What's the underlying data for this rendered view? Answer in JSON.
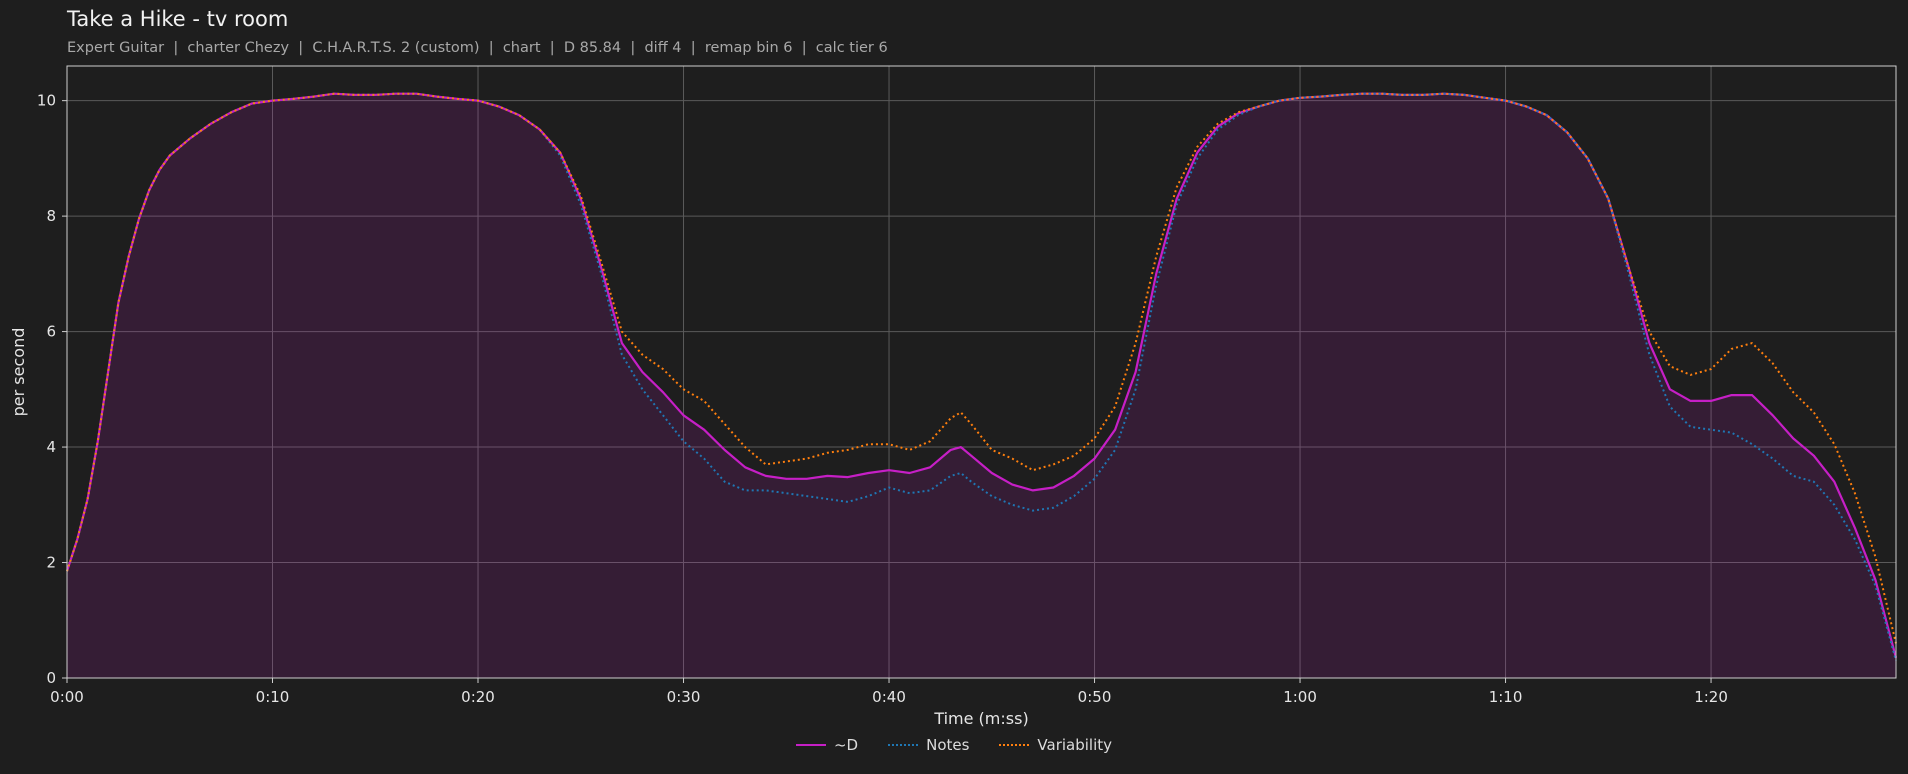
{
  "chart_data": {
    "type": "area",
    "title": "Take a Hike - tv room",
    "subtitle": "Expert Guitar  |  charter Chezy  |  C.H.A.R.T.S. 2 (custom)  |  chart  |  D 85.84  |  diff 4  |  remap bin 6  |  calc tier 6",
    "xlabel": "Time (m:ss)",
    "ylabel": "per second",
    "xlim": [
      0,
      89
    ],
    "ylim": [
      0,
      10.6
    ],
    "x_ticks": [
      0,
      10,
      20,
      30,
      40,
      50,
      60,
      70,
      80
    ],
    "x_tick_labels": [
      "0:00",
      "0:10",
      "0:20",
      "0:30",
      "0:40",
      "0:50",
      "1:00",
      "1:10",
      "1:20"
    ],
    "y_ticks": [
      0,
      2,
      4,
      6,
      8,
      10
    ],
    "y_tick_labels": [
      "0",
      "2",
      "4",
      "6",
      "8",
      "10"
    ],
    "grid": true,
    "legend_position": "bottom-center",
    "series": [
      {
        "name": "~D",
        "color": "#c61fc6",
        "style": "solid",
        "fill": true,
        "points": [
          [
            0,
            1.85
          ],
          [
            0.5,
            2.4
          ],
          [
            1,
            3.1
          ],
          [
            1.5,
            4.1
          ],
          [
            2,
            5.3
          ],
          [
            2.5,
            6.5
          ],
          [
            3,
            7.3
          ],
          [
            3.5,
            7.95
          ],
          [
            4,
            8.45
          ],
          [
            4.5,
            8.8
          ],
          [
            5,
            9.05
          ],
          [
            6,
            9.35
          ],
          [
            7,
            9.6
          ],
          [
            8,
            9.8
          ],
          [
            9,
            9.95
          ],
          [
            10,
            10.0
          ],
          [
            11,
            10.03
          ],
          [
            12,
            10.07
          ],
          [
            13,
            10.12
          ],
          [
            14,
            10.1
          ],
          [
            15,
            10.1
          ],
          [
            16,
            10.12
          ],
          [
            17,
            10.12
          ],
          [
            18,
            10.07
          ],
          [
            19,
            10.03
          ],
          [
            20,
            10.0
          ],
          [
            21,
            9.9
          ],
          [
            22,
            9.75
          ],
          [
            23,
            9.5
          ],
          [
            24,
            9.1
          ],
          [
            25,
            8.3
          ],
          [
            26,
            7.1
          ],
          [
            27,
            5.8
          ],
          [
            28,
            5.3
          ],
          [
            29,
            4.95
          ],
          [
            30,
            4.55
          ],
          [
            31,
            4.3
          ],
          [
            32,
            3.95
          ],
          [
            33,
            3.65
          ],
          [
            34,
            3.5
          ],
          [
            35,
            3.45
          ],
          [
            36,
            3.45
          ],
          [
            37,
            3.5
          ],
          [
            38,
            3.48
          ],
          [
            39,
            3.55
          ],
          [
            40,
            3.6
          ],
          [
            41,
            3.55
          ],
          [
            42,
            3.65
          ],
          [
            43,
            3.95
          ],
          [
            43.5,
            4.0
          ],
          [
            44,
            3.85
          ],
          [
            45,
            3.55
          ],
          [
            46,
            3.35
          ],
          [
            47,
            3.25
          ],
          [
            48,
            3.3
          ],
          [
            49,
            3.5
          ],
          [
            50,
            3.8
          ],
          [
            51,
            4.3
          ],
          [
            52,
            5.3
          ],
          [
            53,
            7.0
          ],
          [
            54,
            8.3
          ],
          [
            55,
            9.1
          ],
          [
            56,
            9.55
          ],
          [
            57,
            9.78
          ],
          [
            58,
            9.9
          ],
          [
            59,
            10.0
          ],
          [
            60,
            10.05
          ],
          [
            61,
            10.07
          ],
          [
            62,
            10.1
          ],
          [
            63,
            10.12
          ],
          [
            64,
            10.12
          ],
          [
            65,
            10.1
          ],
          [
            66,
            10.1
          ],
          [
            67,
            10.12
          ],
          [
            68,
            10.1
          ],
          [
            69,
            10.05
          ],
          [
            70,
            10.0
          ],
          [
            71,
            9.9
          ],
          [
            72,
            9.75
          ],
          [
            73,
            9.45
          ],
          [
            74,
            9.0
          ],
          [
            75,
            8.3
          ],
          [
            76,
            7.1
          ],
          [
            77,
            5.8
          ],
          [
            78,
            5.0
          ],
          [
            79,
            4.8
          ],
          [
            80,
            4.8
          ],
          [
            81,
            4.9
          ],
          [
            82,
            4.9
          ],
          [
            83,
            4.55
          ],
          [
            84,
            4.15
          ],
          [
            85,
            3.85
          ],
          [
            86,
            3.4
          ],
          [
            87,
            2.6
          ],
          [
            88,
            1.7
          ],
          [
            89,
            0.35
          ]
        ]
      },
      {
        "name": "Notes",
        "color": "#1f77b4",
        "style": "dotted",
        "fill": false,
        "points": [
          [
            0,
            1.85
          ],
          [
            0.5,
            2.4
          ],
          [
            1,
            3.1
          ],
          [
            1.5,
            4.1
          ],
          [
            2,
            5.3
          ],
          [
            2.5,
            6.5
          ],
          [
            3,
            7.3
          ],
          [
            3.5,
            7.95
          ],
          [
            4,
            8.45
          ],
          [
            4.5,
            8.8
          ],
          [
            5,
            9.05
          ],
          [
            6,
            9.35
          ],
          [
            7,
            9.6
          ],
          [
            8,
            9.8
          ],
          [
            9,
            9.95
          ],
          [
            10,
            10.0
          ],
          [
            11,
            10.03
          ],
          [
            12,
            10.07
          ],
          [
            13,
            10.12
          ],
          [
            14,
            10.1
          ],
          [
            15,
            10.1
          ],
          [
            16,
            10.12
          ],
          [
            17,
            10.12
          ],
          [
            18,
            10.07
          ],
          [
            19,
            10.03
          ],
          [
            20,
            10.0
          ],
          [
            21,
            9.9
          ],
          [
            22,
            9.75
          ],
          [
            23,
            9.5
          ],
          [
            24,
            9.05
          ],
          [
            25,
            8.2
          ],
          [
            26,
            7.0
          ],
          [
            27,
            5.6
          ],
          [
            28,
            5.0
          ],
          [
            29,
            4.55
          ],
          [
            30,
            4.1
          ],
          [
            31,
            3.8
          ],
          [
            32,
            3.4
          ],
          [
            33,
            3.25
          ],
          [
            34,
            3.25
          ],
          [
            35,
            3.2
          ],
          [
            36,
            3.15
          ],
          [
            37,
            3.1
          ],
          [
            38,
            3.05
          ],
          [
            39,
            3.15
          ],
          [
            40,
            3.3
          ],
          [
            41,
            3.2
          ],
          [
            42,
            3.25
          ],
          [
            43,
            3.5
          ],
          [
            43.5,
            3.55
          ],
          [
            44,
            3.4
          ],
          [
            45,
            3.15
          ],
          [
            46,
            3.0
          ],
          [
            47,
            2.9
          ],
          [
            48,
            2.95
          ],
          [
            49,
            3.15
          ],
          [
            50,
            3.45
          ],
          [
            51,
            3.95
          ],
          [
            52,
            5.0
          ],
          [
            53,
            6.8
          ],
          [
            54,
            8.2
          ],
          [
            55,
            9.0
          ],
          [
            56,
            9.5
          ],
          [
            57,
            9.75
          ],
          [
            58,
            9.9
          ],
          [
            59,
            10.0
          ],
          [
            60,
            10.05
          ],
          [
            61,
            10.07
          ],
          [
            62,
            10.1
          ],
          [
            63,
            10.12
          ],
          [
            64,
            10.12
          ],
          [
            65,
            10.1
          ],
          [
            66,
            10.1
          ],
          [
            67,
            10.12
          ],
          [
            68,
            10.1
          ],
          [
            69,
            10.05
          ],
          [
            70,
            10.0
          ],
          [
            71,
            9.9
          ],
          [
            72,
            9.75
          ],
          [
            73,
            9.45
          ],
          [
            74,
            9.0
          ],
          [
            75,
            8.3
          ],
          [
            76,
            7.0
          ],
          [
            77,
            5.6
          ],
          [
            78,
            4.7
          ],
          [
            79,
            4.35
          ],
          [
            80,
            4.3
          ],
          [
            81,
            4.25
          ],
          [
            82,
            4.05
          ],
          [
            83,
            3.8
          ],
          [
            84,
            3.5
          ],
          [
            85,
            3.4
          ],
          [
            86,
            3.0
          ],
          [
            87,
            2.4
          ],
          [
            88,
            1.6
          ],
          [
            89,
            0.3
          ]
        ]
      },
      {
        "name": "Variability",
        "color": "#ff7f0e",
        "style": "dotted",
        "fill": false,
        "points": [
          [
            0,
            1.85
          ],
          [
            0.5,
            2.4
          ],
          [
            1,
            3.1
          ],
          [
            1.5,
            4.1
          ],
          [
            2,
            5.3
          ],
          [
            2.5,
            6.5
          ],
          [
            3,
            7.3
          ],
          [
            3.5,
            7.95
          ],
          [
            4,
            8.45
          ],
          [
            4.5,
            8.8
          ],
          [
            5,
            9.05
          ],
          [
            6,
            9.35
          ],
          [
            7,
            9.6
          ],
          [
            8,
            9.8
          ],
          [
            9,
            9.95
          ],
          [
            10,
            10.0
          ],
          [
            11,
            10.03
          ],
          [
            12,
            10.07
          ],
          [
            13,
            10.12
          ],
          [
            14,
            10.1
          ],
          [
            15,
            10.1
          ],
          [
            16,
            10.12
          ],
          [
            17,
            10.12
          ],
          [
            18,
            10.07
          ],
          [
            19,
            10.03
          ],
          [
            20,
            10.0
          ],
          [
            21,
            9.9
          ],
          [
            22,
            9.75
          ],
          [
            23,
            9.5
          ],
          [
            24,
            9.1
          ],
          [
            25,
            8.35
          ],
          [
            26,
            7.2
          ],
          [
            27,
            6.0
          ],
          [
            28,
            5.6
          ],
          [
            29,
            5.35
          ],
          [
            30,
            5.0
          ],
          [
            31,
            4.8
          ],
          [
            32,
            4.4
          ],
          [
            33,
            4.0
          ],
          [
            34,
            3.7
          ],
          [
            35,
            3.75
          ],
          [
            36,
            3.8
          ],
          [
            37,
            3.9
          ],
          [
            38,
            3.95
          ],
          [
            39,
            4.05
          ],
          [
            40,
            4.05
          ],
          [
            41,
            3.95
          ],
          [
            42,
            4.1
          ],
          [
            43,
            4.5
          ],
          [
            43.5,
            4.6
          ],
          [
            44,
            4.4
          ],
          [
            45,
            3.95
          ],
          [
            46,
            3.8
          ],
          [
            47,
            3.6
          ],
          [
            48,
            3.7
          ],
          [
            49,
            3.85
          ],
          [
            50,
            4.15
          ],
          [
            51,
            4.7
          ],
          [
            52,
            5.8
          ],
          [
            53,
            7.3
          ],
          [
            54,
            8.5
          ],
          [
            55,
            9.2
          ],
          [
            56,
            9.6
          ],
          [
            57,
            9.8
          ],
          [
            58,
            9.9
          ],
          [
            59,
            10.0
          ],
          [
            60,
            10.05
          ],
          [
            61,
            10.07
          ],
          [
            62,
            10.1
          ],
          [
            63,
            10.12
          ],
          [
            64,
            10.12
          ],
          [
            65,
            10.1
          ],
          [
            66,
            10.1
          ],
          [
            67,
            10.12
          ],
          [
            68,
            10.1
          ],
          [
            69,
            10.05
          ],
          [
            70,
            10.0
          ],
          [
            71,
            9.9
          ],
          [
            72,
            9.75
          ],
          [
            73,
            9.45
          ],
          [
            74,
            9.0
          ],
          [
            75,
            8.3
          ],
          [
            76,
            7.1
          ],
          [
            77,
            6.0
          ],
          [
            78,
            5.4
          ],
          [
            79,
            5.25
          ],
          [
            80,
            5.35
          ],
          [
            81,
            5.7
          ],
          [
            82,
            5.8
          ],
          [
            83,
            5.45
          ],
          [
            84,
            4.95
          ],
          [
            85,
            4.6
          ],
          [
            86,
            4.05
          ],
          [
            87,
            3.2
          ],
          [
            88,
            2.1
          ],
          [
            89,
            0.6
          ]
        ]
      }
    ]
  }
}
